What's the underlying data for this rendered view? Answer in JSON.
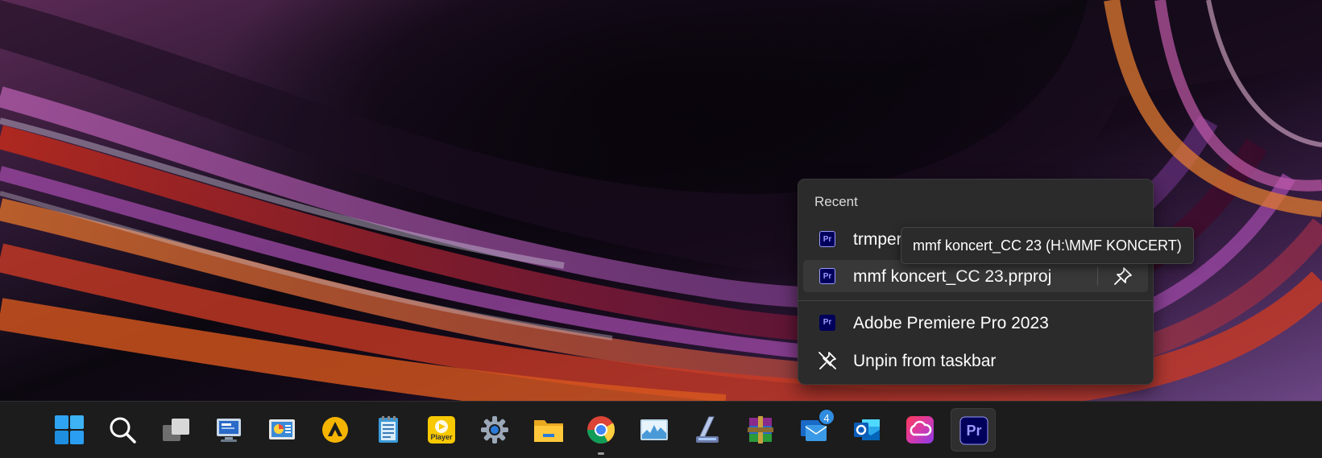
{
  "jumplist": {
    "section_title": "Recent",
    "recent_items": [
      {
        "label": "trmper",
        "icon": "premiere-project-icon"
      },
      {
        "label": "mmf koncert_CC 23.prproj",
        "icon": "premiere-project-icon"
      }
    ],
    "app_label": "Adobe Premiere Pro 2023",
    "unpin_label": "Unpin from taskbar",
    "pr_glyph": "Pr"
  },
  "tooltip": {
    "text": "mmf koncert_CC 23 (H:\\MMF KONCERT)"
  },
  "taskbar": {
    "outlook_badge": "4",
    "player_label": "Player",
    "premiere_glyph": "Pr",
    "apps": [
      {
        "name": "start-icon"
      },
      {
        "name": "search-icon"
      },
      {
        "name": "task-view-icon"
      },
      {
        "name": "remote-desktop-icon"
      },
      {
        "name": "presentation-icon"
      },
      {
        "name": "aimp-icon"
      },
      {
        "name": "notepad-icon"
      },
      {
        "name": "media-player-icon"
      },
      {
        "name": "settings-icon"
      },
      {
        "name": "file-explorer-icon"
      },
      {
        "name": "chrome-icon"
      },
      {
        "name": "resource-monitor-icon"
      },
      {
        "name": "scanner-icon"
      },
      {
        "name": "winrar-icon"
      },
      {
        "name": "mail-icon"
      },
      {
        "name": "outlook-icon"
      },
      {
        "name": "creative-cloud-icon"
      },
      {
        "name": "premiere-pro-icon"
      }
    ]
  },
  "colors": {
    "menu_bg": "#2b2b2b",
    "taskbar_bg": "#1c1c1c",
    "premiere_bg": "#00005b",
    "premiere_accent": "#9999ff"
  }
}
